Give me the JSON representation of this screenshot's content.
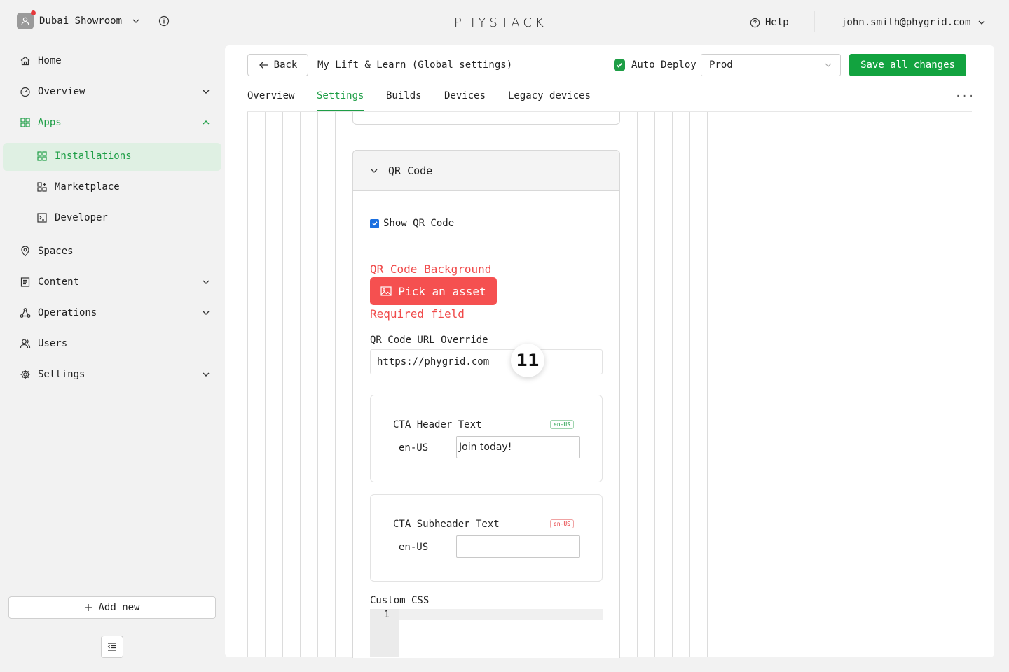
{
  "header": {
    "org_name": "Dubai Showroom",
    "logo_text": "PHYSTACK",
    "help_label": "Help",
    "user_email": "john.smith@phygrid.com"
  },
  "sidebar": {
    "items": [
      {
        "label": "Home"
      },
      {
        "label": "Overview"
      },
      {
        "label": "Apps"
      },
      {
        "label": "Spaces"
      },
      {
        "label": "Content"
      },
      {
        "label": "Operations"
      },
      {
        "label": "Users"
      },
      {
        "label": "Settings"
      }
    ],
    "apps_children": [
      {
        "label": "Installations"
      },
      {
        "label": "Marketplace"
      },
      {
        "label": "Developer"
      }
    ],
    "add_new_label": "Add new"
  },
  "toolbar": {
    "back_label": "Back",
    "page_title": "My Lift & Learn (Global settings)",
    "auto_deploy_label": "Auto Deploy",
    "auto_deploy_checked": true,
    "environment": "Prod",
    "save_label": "Save all changes"
  },
  "tabs": [
    {
      "label": "Overview"
    },
    {
      "label": "Settings",
      "active": true
    },
    {
      "label": "Builds"
    },
    {
      "label": "Devices"
    },
    {
      "label": "Legacy devices"
    }
  ],
  "more_label": "...",
  "qr_section": {
    "title": "QR Code",
    "show_qr_label": "Show QR Code",
    "show_qr_checked": true,
    "background_label": "QR Code Background",
    "pick_asset_label": "Pick an asset",
    "required_label": "Required field",
    "url_override_label": "QR Code URL Override",
    "url_override_value": "https://phygrid.com",
    "step_badge": "11",
    "cta_header": {
      "label": "CTA Header Text",
      "locale_tag": "en-US",
      "lang": "en-US",
      "value": "Join today!"
    },
    "cta_subheader": {
      "label": "CTA Subheader Text",
      "locale_tag": "en-US",
      "lang": "en-US",
      "value": ""
    },
    "custom_css_label": "Custom CSS",
    "editor_line_number": "1"
  },
  "colors": {
    "brand_green": "#1e9e46",
    "save_green": "#12a33f",
    "error_red": "#f04a4a",
    "checkbox_blue": "#1a6fe0"
  }
}
